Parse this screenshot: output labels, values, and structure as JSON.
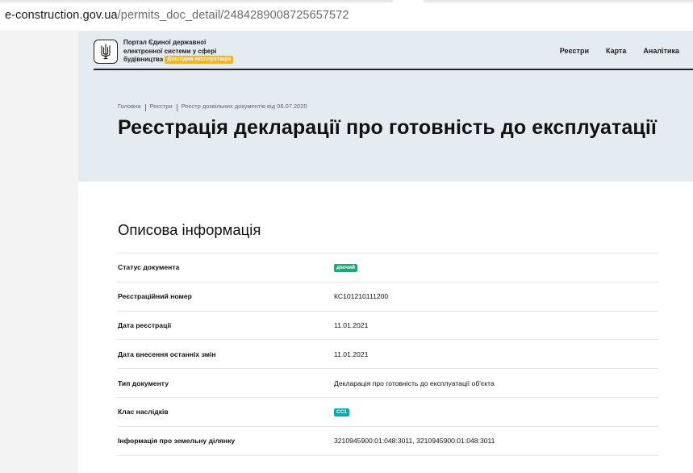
{
  "browser": {
    "url_host": "e-construction.gov.ua",
    "url_path": "/permits_doc_detail/2484289008725657572"
  },
  "header": {
    "portal_line1": "Портал Єдиної державної",
    "portal_line2": "електронної системи у сфері",
    "portal_line3": "будівництва",
    "badge": "Дослідна експлуатація",
    "nav": [
      "Реєстри",
      "Карта",
      "Аналітика"
    ]
  },
  "breadcrumb": [
    "Головна",
    "Реєстри",
    "Реєстр дозвільних документів від 06.07.2020"
  ],
  "page_title": "Реєстрація декларації про готовність до експлуатації",
  "section_title": "Описова інформація",
  "rows": [
    {
      "key": "Статус документа",
      "value": "діючий",
      "type": "pill-green"
    },
    {
      "key": "Реєстраційний номер",
      "value": "КС101210111200",
      "type": "text"
    },
    {
      "key": "Дата реєстрації",
      "value": "11.01.2021",
      "type": "text"
    },
    {
      "key": "Дата внесення останніх змін",
      "value": "11.01.2021",
      "type": "text"
    },
    {
      "key": "Тип документу",
      "value": "Декларація про готовність до експлуатації об'єкта",
      "type": "text"
    },
    {
      "key": "Клас наслідків",
      "value": "СС1",
      "type": "pill-teal"
    },
    {
      "key": "Інформація про земельну ділянку",
      "value": "3210945900:01:048:3011, 3210945900:01:048:3011",
      "type": "text"
    }
  ],
  "colors": {
    "hero_bg": "#e4ebf1",
    "badge_orange": "#f0b429",
    "status_green": "#1fa77a",
    "class_teal": "#12a6ad"
  },
  "icons": {
    "logo": "trident-icon"
  }
}
